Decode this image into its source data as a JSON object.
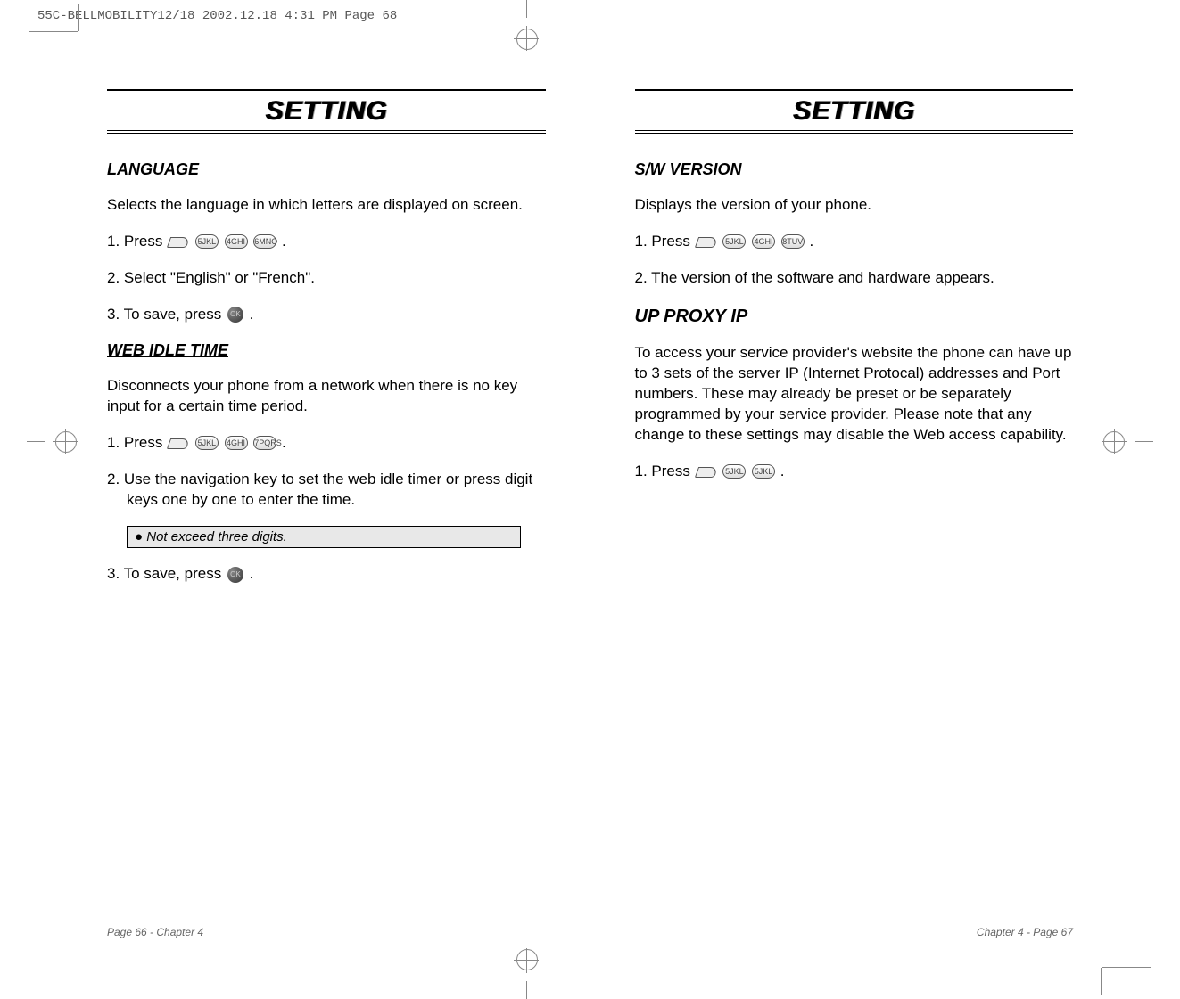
{
  "header_line": "55C-BELLMOBILITY12/18  2002.12.18  4:31 PM  Page 68",
  "left": {
    "title": "SETTING",
    "sections": {
      "language": {
        "heading": "LANGUAGE",
        "body": "Selects the language in which letters are displayed on screen.",
        "step1_prefix": "1. Press",
        "step1_keys": [
          "5JKL",
          "4GHI",
          "6MNO"
        ],
        "step1_suffix": ".",
        "step2": "2. Select \"English\" or \"French\".",
        "step3_prefix": "3. To save, press",
        "step3_suffix": "."
      },
      "webidle": {
        "heading": "WEB IDLE TIME",
        "body": "Disconnects your phone from a network when there is no key input for a certain time period.",
        "step1_prefix": "1. Press",
        "step1_keys": [
          "5JKL",
          "4GHI",
          "7PQRS"
        ],
        "step1_suffix": ".",
        "step2": "2. Use the navigation key to set the web idle timer or press digit keys one by one to enter the time.",
        "note": "Not exceed three digits.",
        "step3_prefix": "3. To save, press",
        "step3_suffix": "."
      }
    },
    "footer": "Page 66 - Chapter 4"
  },
  "right": {
    "title": "SETTING",
    "sections": {
      "swversion": {
        "heading": "S/W VERSION",
        "body": "Displays the version of your phone.",
        "step1_prefix": "1. Press",
        "step1_keys": [
          "5JKL",
          "4GHI",
          "8TUV"
        ],
        "step1_suffix": ".",
        "step2": "2. The version of the software and hardware appears."
      },
      "upproxy": {
        "heading": "UP PROXY IP",
        "body": "To access your service provider's website the phone can have up to 3 sets of the server IP (Internet Protocal) addresses and Port numbers. These may already be preset or be separately programmed by your service provider. Please note that any change to these settings may disable the Web access capability.",
        "step1_prefix": "1. Press",
        "step1_keys": [
          "5JKL",
          "5JKL"
        ],
        "step1_suffix": "."
      }
    },
    "footer": "Chapter 4 - Page 67"
  }
}
